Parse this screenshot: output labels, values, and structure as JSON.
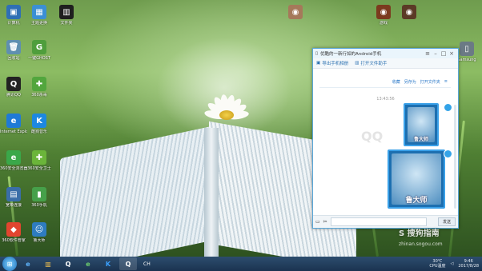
{
  "desktop": {
    "icons": [
      {
        "label": "计算机",
        "icon": "computer-icon",
        "color": "#2f6fb5",
        "glyph": "▣"
      },
      {
        "label": "回收站",
        "icon": "recycle-bin-icon",
        "color": "#5f8fb0",
        "glyph": "🗑"
      },
      {
        "label": "腾讯QQ",
        "icon": "qq-penguin-icon",
        "color": "#222222",
        "glyph": "Q"
      },
      {
        "label": "Internet Explorer",
        "icon": "ie-icon",
        "color": "#1f7ad6",
        "glyph": "e"
      },
      {
        "label": "360安全浏览器",
        "icon": "360-browser-icon",
        "color": "#3aa84a",
        "glyph": "e"
      },
      {
        "label": "宽带连接",
        "icon": "network-icon",
        "color": "#3a6ea8",
        "glyph": "▤"
      },
      {
        "label": "360软件管家",
        "icon": "360-manager-icon",
        "color": "#e2452f",
        "glyph": "◆"
      },
      {
        "label": "主题更换",
        "icon": "theme-icon",
        "color": "#3b8fd4",
        "glyph": "▦"
      },
      {
        "label": "一键GHOST",
        "icon": "ghost-icon",
        "color": "#4f9e3c",
        "glyph": "G"
      },
      {
        "label": "360杀毒",
        "icon": "360-antivirus-icon",
        "color": "#52a63d",
        "glyph": "✚"
      },
      {
        "label": "酷狗音乐",
        "icon": "kugou-icon",
        "color": "#1d88e0",
        "glyph": "K"
      },
      {
        "label": "360安全卫士",
        "icon": "360-guard-icon",
        "color": "#6bb53a",
        "glyph": "✚"
      },
      {
        "label": "360手机",
        "icon": "360-phone-icon",
        "color": "#46a04a",
        "glyph": "▮"
      },
      {
        "label": "鲁大师",
        "icon": "ludashi-icon",
        "color": "#2e7cc0",
        "glyph": "☺"
      },
      {
        "label": "文件夹",
        "icon": "folder-icon",
        "color": "#1f1f1f",
        "glyph": "▥"
      },
      {
        "label": "游戏",
        "icon": "game-icon",
        "color": "#7b3a1e",
        "glyph": "◉"
      },
      {
        "label": "Samsung",
        "icon": "phone-app-icon",
        "color": "#6b7a85",
        "glyph": "▯"
      }
    ]
  },
  "qq_window": {
    "title": "优酷的一新行如的Android手机",
    "toolbar": {
      "export_label": "导出手机相册",
      "open_label": "打开文件助手"
    },
    "links": [
      "收藏",
      "另存为",
      "打开文件夹"
    ],
    "timestamp": "13:43:56",
    "watermark": "QQ",
    "images": [
      {
        "caption": "鲁大师"
      },
      {
        "caption": "鲁大师"
      }
    ],
    "send_label": "发送"
  },
  "taskbar": {
    "items": [
      {
        "icon": "start-icon",
        "label": "⊞"
      },
      {
        "icon": "ie-taskbar-icon",
        "label": "e"
      },
      {
        "icon": "explorer-taskbar-icon",
        "label": "▥"
      },
      {
        "icon": "qq-taskbar-icon",
        "label": "Q"
      },
      {
        "icon": "360-taskbar-icon",
        "label": "e"
      },
      {
        "icon": "kugou-taskbar-icon",
        "label": "K"
      },
      {
        "icon": "qq-chat-taskbar-icon",
        "label": "Q"
      }
    ],
    "lang": "CH",
    "cpu_temp": "30℃",
    "cpu_label": "CPU温度",
    "time": "9:46",
    "date": "2017/8/28"
  },
  "site_watermark": {
    "brand": "S 搜狗指南",
    "url": "zhinan.sogou.com"
  }
}
